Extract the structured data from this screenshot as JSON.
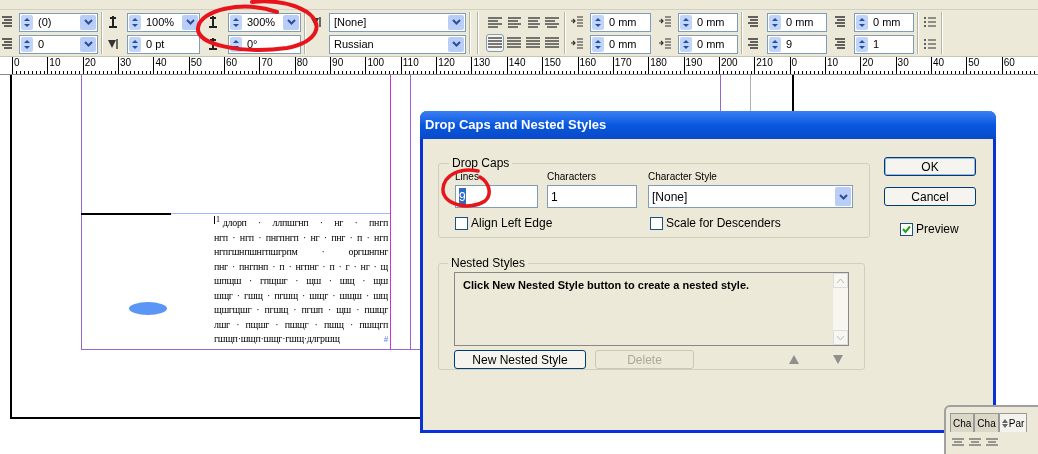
{
  "control_panel": {
    "kerning": {
      "value": "(0)"
    },
    "tracking": {
      "value": "0"
    },
    "vertical_scale": {
      "value": "100%"
    },
    "baseline_shift": {
      "value": "0 pt"
    },
    "horizontal_scale": {
      "value": "300%"
    },
    "skew": {
      "value": "0°"
    },
    "character_style": {
      "value": "[None]"
    },
    "language": {
      "value": "Russian"
    },
    "align_buttons": [
      {
        "selected": false
      },
      {
        "selected": false
      },
      {
        "selected": false
      },
      {
        "selected": false
      },
      {
        "selected": true
      },
      {
        "selected": false
      },
      {
        "selected": false
      },
      {
        "selected": false
      }
    ],
    "left_indent": {
      "value": "0 mm"
    },
    "right_indent": {
      "value": "0 mm"
    },
    "first_line_indent": {
      "value": "0 mm"
    },
    "last_line_indent": {
      "value": "0 mm"
    },
    "space_before": {
      "value": "0 mm"
    },
    "space_after": {
      "value": "0 mm"
    },
    "drop_cap_lines": {
      "value": "9"
    },
    "drop_cap_characters": {
      "value": "1"
    }
  },
  "ruler": {
    "labels": [
      "0",
      "10",
      "20",
      "30",
      "40",
      "50",
      "60",
      "70",
      "80",
      "90",
      "100",
      "110",
      "120",
      "130",
      "140",
      "150",
      "160",
      "170",
      "180",
      "190",
      "200",
      "210",
      "0",
      "10",
      "20",
      "30",
      "40",
      "50",
      "60"
    ]
  },
  "text_frame": {
    "drop_cap": "1",
    "lines": [
      "длорп · ллпшгнп · нг · пнгп",
      "нгп · нгп · пнгпнгп · нг · пнг · п · нгп",
      "нгпгшнпшнгпшгрпм · оргшнпнг",
      "пнг · пнгпнп · п · нгпнг · п · г · нг · щ",
      "шпщш · гпщшг · щш · шщ · щш",
      "шщг · гшщ · пгшщ · шщг · шщш · шщ",
      "щшгщшг · пгшщ · пгшп · щш · пшщг",
      "лшг · пщшг · пшщг · пшщ · пшщгп",
      "гшщп·шщп·шщг·гшщ·длгршщ"
    ],
    "end_mark": "#"
  },
  "dialog": {
    "title": "Drop Caps and Nested Styles",
    "drop_caps": {
      "label": "Drop Caps",
      "lines": {
        "label": "Lines",
        "value": "9",
        "selected_text": true
      },
      "characters": {
        "label": "Characters",
        "value": "1"
      },
      "character_style": {
        "label": "Character Style",
        "value": "[None]"
      },
      "align_left_edge": {
        "label": "Align Left Edge",
        "checked": false
      },
      "scale_for_descenders": {
        "label": "Scale for Descenders",
        "checked": false
      }
    },
    "nested_styles": {
      "label": "Nested Styles",
      "message": "Click New Nested Style button to create a nested style.",
      "new_button": {
        "label": "New Nested Style",
        "disabled": false
      },
      "delete_button": {
        "label": "Delete",
        "disabled": true
      }
    },
    "ok": "OK",
    "cancel": "Cancel",
    "preview": {
      "label": "Preview",
      "checked": true
    }
  },
  "floating_panel": {
    "tabs": [
      {
        "label": "Cha",
        "selected": false
      },
      {
        "label": "Cha",
        "selected": false
      },
      {
        "label": "Par",
        "selected": true
      }
    ]
  }
}
